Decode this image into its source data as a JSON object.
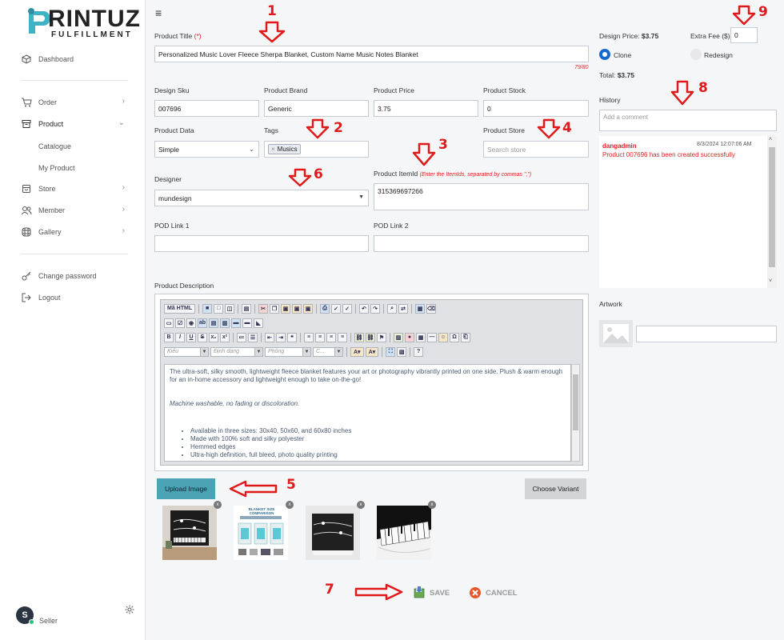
{
  "brand": {
    "name": "RINTUZ",
    "sub": "FULFILLMENT"
  },
  "sidebar": {
    "items": [
      {
        "label": "Dashboard",
        "icon": "cube-icon"
      },
      {
        "label": "Order",
        "icon": "cart-icon"
      },
      {
        "label": "Product",
        "icon": "archive-icon"
      },
      {
        "label": "Store",
        "icon": "store-icon"
      },
      {
        "label": "Member",
        "icon": "users-icon"
      },
      {
        "label": "Gallery",
        "icon": "gallery-icon"
      },
      {
        "label": "Change password",
        "icon": "key-icon"
      },
      {
        "label": "Logout",
        "icon": "logout-icon"
      }
    ],
    "product_sub": [
      "Catalogue",
      "My Product"
    ],
    "user": {
      "initial": "S",
      "name": "Seller"
    }
  },
  "form": {
    "title_label": "Product Title ",
    "title_req": "(*)",
    "title_value": "Personalized Music Lover Fleece Sherpa Blanket, Custom Name Music Notes Blanket",
    "title_counter": "79/80",
    "design_sku_label": "Design Sku",
    "design_sku": "007696",
    "brand_label": "Product Brand",
    "brand": "Generic",
    "price_label": "Product Price",
    "price": "3.75",
    "stock_label": "Product Stock",
    "stock": "0",
    "data_label": "Product Data",
    "data_value": "Simple",
    "tags_label": "Tags",
    "tag": "Musics",
    "store_label": "Product Store",
    "store_placeholder": "Search store",
    "designer_label": "Designer",
    "designer": "mundesign",
    "itemid_label": "Product ItemId ",
    "itemid_hint": "(Enter the ItemIds, separated by commas \",\")",
    "itemid": "315369697266",
    "pod1_label": "POD Link 1",
    "pod2_label": "POD Link 2",
    "desc_label": "Product Description"
  },
  "editor": {
    "source_btn": "Mã HTML",
    "style_sel": "Kiểu",
    "format_sel": "Định dạng",
    "font_sel": "Phông",
    "size_sel": "C...",
    "para1": "The ultra-soft, silky smooth, lightweight fleece blanket features your art or photography vibrantly printed on one side. Plush & warm enough for an in-home accessory and lightweight enough to take on-the-go!",
    "para2": "Machine washable, no fading or discoloration.",
    "bullets": [
      "Available in three sizes: 30x40, 50x60, and 60x80 inches",
      "Made with 100% soft and silky polyester",
      "Hemmed edges",
      "Ultra-high definition, full bleed, photo quality printing"
    ]
  },
  "buttons": {
    "upload": "Upload Image",
    "variant": "Choose Variant",
    "save": "SAVE",
    "cancel": "CANCEL"
  },
  "thumbs": {
    "comparison_title": "BLANKET SIZE COMPARISON",
    "x": "x"
  },
  "right": {
    "design_price_label": "Design Price: ",
    "design_price": "$3.75",
    "extra_fee_label": "Extra Fee ($):",
    "extra_fee": "0",
    "clone": "Clone",
    "redesign": "Redesign",
    "total_label": "Total: ",
    "total": "$3.75",
    "history_label": "History",
    "comment_placeholder": "Add a comment",
    "history_user": "dangadmin",
    "history_time": "8/3/2024 12:07:06 AM",
    "history_msg": "Product 007696 has been created successfully",
    "artwork_label": "Artwork"
  },
  "annotations": [
    "1",
    "2",
    "3",
    "4",
    "5",
    "6",
    "7",
    "8",
    "9"
  ]
}
